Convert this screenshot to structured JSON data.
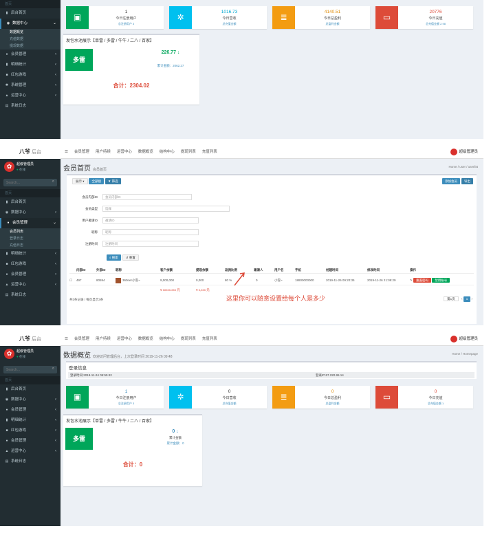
{
  "panel1": {
    "sidebar": {
      "items": [
        {
          "label": "首页",
          "icon": "home-icon"
        },
        {
          "label": "后台首页",
          "icon": "chart-icon"
        },
        {
          "label": "数据中心",
          "icon": "dashboard-icon"
        }
      ],
      "subs": [
        "数据概览",
        "充值数据",
        "提现数据"
      ],
      "items2": [
        {
          "label": "会员管理",
          "icon": "user-icon"
        },
        {
          "label": "明细统计",
          "icon": "chart-icon"
        },
        {
          "label": "红包游戏",
          "icon": "gift-icon"
        },
        {
          "label": "系统管理",
          "icon": "gear-icon"
        },
        {
          "label": "运营中心",
          "icon": "cart-icon"
        },
        {
          "label": "系统日志",
          "icon": "file-icon"
        }
      ]
    },
    "kpis": [
      {
        "value": "1",
        "label": "今日注册用户",
        "link": "总注册用户 3"
      },
      {
        "value": "1016.73",
        "label": "今日营收",
        "link": "总充值金额"
      },
      {
        "value": "4140.51",
        "label": "今日总盈利",
        "link": "总盈利金额"
      },
      {
        "value": "20776",
        "label": "今日充值",
        "link": "总充值金额 2.98"
      }
    ],
    "box_title": "发包水池展示【单雷 / 多雷 / 牛牛 / 二八 / 百家】",
    "tile": "多雷",
    "stat_value": "226.77 ↓",
    "stat_sub": "累计金额：2062.27",
    "total_label": "合计：",
    "total_value": "2304.02"
  },
  "panel2": {
    "brand": "八爷",
    "brand_sub": "后台",
    "nav": [
      "会员管理",
      "用户持续",
      "运营中心",
      "数据概览",
      "结构中心",
      "提现列表",
      "充值列表"
    ],
    "admin": "超级管理员",
    "user_name": "超级管理员",
    "user_status": "在线",
    "search_placeholder": "Search...",
    "sidebar": {
      "header": "首页",
      "items": [
        {
          "label": "后台首页",
          "icon": "chart-icon"
        },
        {
          "label": "数据中心",
          "icon": "dashboard-icon"
        },
        {
          "label": "会员管理",
          "icon": "user-icon"
        }
      ],
      "subs": [
        "会员列表",
        "登录日志",
        "充值日志"
      ],
      "items2": [
        {
          "label": "明细统计",
          "icon": "chart-icon"
        },
        {
          "label": "红包游戏",
          "icon": "gift-icon"
        },
        {
          "label": "会员管理",
          "icon": "user-icon"
        },
        {
          "label": "运营中心",
          "icon": "cart-icon"
        },
        {
          "label": "系统日志",
          "icon": "file-icon"
        }
      ]
    },
    "page_title": "会员首页",
    "page_small": "会员首页",
    "breadcrumb": "Home  /  user  /  userlist",
    "toolbar": {
      "select": "展示",
      "btn_search": "全部搜",
      "btn_filter": "筛选",
      "btn_add": "添加会员",
      "btn_more": "导出"
    },
    "form": {
      "labels": [
        "会员内部ID",
        "会员类型",
        "用户邀请ID",
        "昵称",
        "注册时间"
      ],
      "placeholders": [
        "会员内部ID",
        "选择",
        "邀请ID",
        "昵称",
        "注册时间"
      ],
      "search": "搜索",
      "reset": "重置"
    },
    "table": {
      "headers": [
        "内部ID",
        "外部ID",
        "昵称",
        "客户余额",
        "提现余额",
        "返佣比例",
        "邀请人",
        "用户名",
        "手机",
        "创建时间",
        "修改时间",
        "操作"
      ],
      "row": [
        "497",
        "80594",
        "360ner小雪~",
        "9,000,000",
        "0,000",
        "80 %",
        "0",
        "小雪~",
        "18800000000",
        "2019-11-26 09:20:35",
        "2019-11-26 21:09:29"
      ],
      "action_reset": "重置密码",
      "action_disable": "禁用账号",
      "total1": "¥ xxxxx.xxx 元",
      "total2": "¥ x,xxx 元",
      "footer": "共3条记录 / 每页显示3条",
      "pager": "第1页"
    },
    "annotation": "这里你可以随意设置给每个人是多少"
  },
  "panel3": {
    "brand": "八爷",
    "brand_sub": "后台",
    "page_title": "数据概览",
    "page_small": "欢迎访问管理后台，上次登录时间 2019-11-26 09:48",
    "breadcrumb": "Home  /  Homepage",
    "login": {
      "title": "登录信息",
      "time": "登录时间:2019-11-24 09:55:42",
      "ip": "登录IP:67.220.95.14"
    },
    "kpis": [
      {
        "value": "1",
        "label": "今日注册用户",
        "link": "总注册用户 3"
      },
      {
        "value": "0",
        "label": "今日营收",
        "link": "总充值金额"
      },
      {
        "value": "0",
        "label": "今日总盈利",
        "link": "总盈利金额"
      },
      {
        "value": "0",
        "label": "今日充值",
        "link": "总充值金额 1"
      }
    ],
    "box_title": "发包水池展示【单雷 / 多雷 / 牛牛 / 二八 / 百家】",
    "tile": "多雷",
    "stat_value": "0 ↓",
    "stat_label": "累计金额",
    "stat_sub": "累计金额：0",
    "total_label": "合计：",
    "total_value": "0"
  },
  "colors": {
    "sidebar_bg": "#222d32",
    "green": "#00a65a",
    "aqua": "#00c0ef",
    "yellow": "#f39c12",
    "red": "#dd4b39",
    "blue": "#3c8dbc"
  }
}
